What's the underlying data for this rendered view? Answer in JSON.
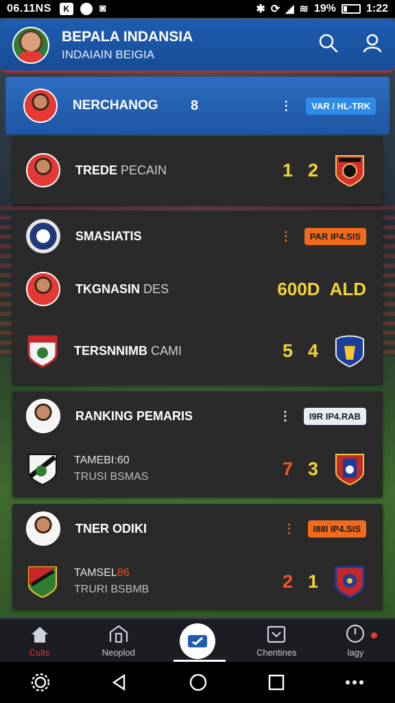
{
  "status_bar": {
    "time": "06.11NS",
    "app_badge": "K",
    "battery_text": "19%",
    "clock": "1:22"
  },
  "header": {
    "title": "BEPALA INDANSIA",
    "subtitle": "INDAIAIN BEIGIA"
  },
  "featured": {
    "name": "NERCHANOG",
    "number": "8",
    "badge": "VAR / HL-TRK",
    "badge_color": "#2e8be8"
  },
  "cards": [
    {
      "rows": [
        {
          "label": "TREDE",
          "label_sub": " PECAIN",
          "score": [
            "1",
            "2"
          ],
          "score_color": "yellow"
        }
      ]
    },
    {
      "rows": [
        {
          "label": "SMASIATIS",
          "badge": "PAR IP4.SIS",
          "badge_style": "orange"
        },
        {
          "label": "TKGNASIN",
          "label_sub": " DES",
          "score": [
            "600D",
            "ALD"
          ],
          "score_color": "yellow"
        },
        {
          "label": "TERSNNIMB",
          "label_sub": " CAMI",
          "score": [
            "5",
            "4"
          ],
          "score_color": "yellow"
        }
      ]
    },
    {
      "rows": [
        {
          "label": "RANKING PEMARIS",
          "badge": "I9R IP4.RAB",
          "badge_style": "white"
        },
        {
          "line1": "TAMEBI:60",
          "line2": "TRUSI BSMAS",
          "score": [
            "7",
            "3"
          ],
          "score_color": "mixed"
        }
      ]
    },
    {
      "rows": [
        {
          "label": "TNER ODIKI",
          "badge": "I88I IP4.SIS",
          "badge_style": "orange"
        },
        {
          "line1": "TAMSEL",
          "line1_accent": "86",
          "line2": "TRURI BSBMB",
          "score": [
            "2",
            "1"
          ],
          "score_color": "mixed"
        }
      ]
    }
  ],
  "bottom_nav": {
    "items": [
      {
        "label": "Cults",
        "icon": "home-icon",
        "active": true
      },
      {
        "label": "Neoplod",
        "icon": "building-icon",
        "active": false
      },
      {
        "label": "",
        "icon": "ticket-icon",
        "active": false
      },
      {
        "label": "Chentines",
        "icon": "inbox-icon",
        "active": false
      },
      {
        "label": "lagy",
        "icon": "clock-icon",
        "active": false
      }
    ]
  },
  "colors": {
    "header_blue": "#1f5db0",
    "card_bg": "#2a2a2b",
    "accent_red": "#e53935",
    "score_yellow": "#f1d430",
    "score_red": "#f0562a",
    "badge_orange": "#f26a1b"
  }
}
